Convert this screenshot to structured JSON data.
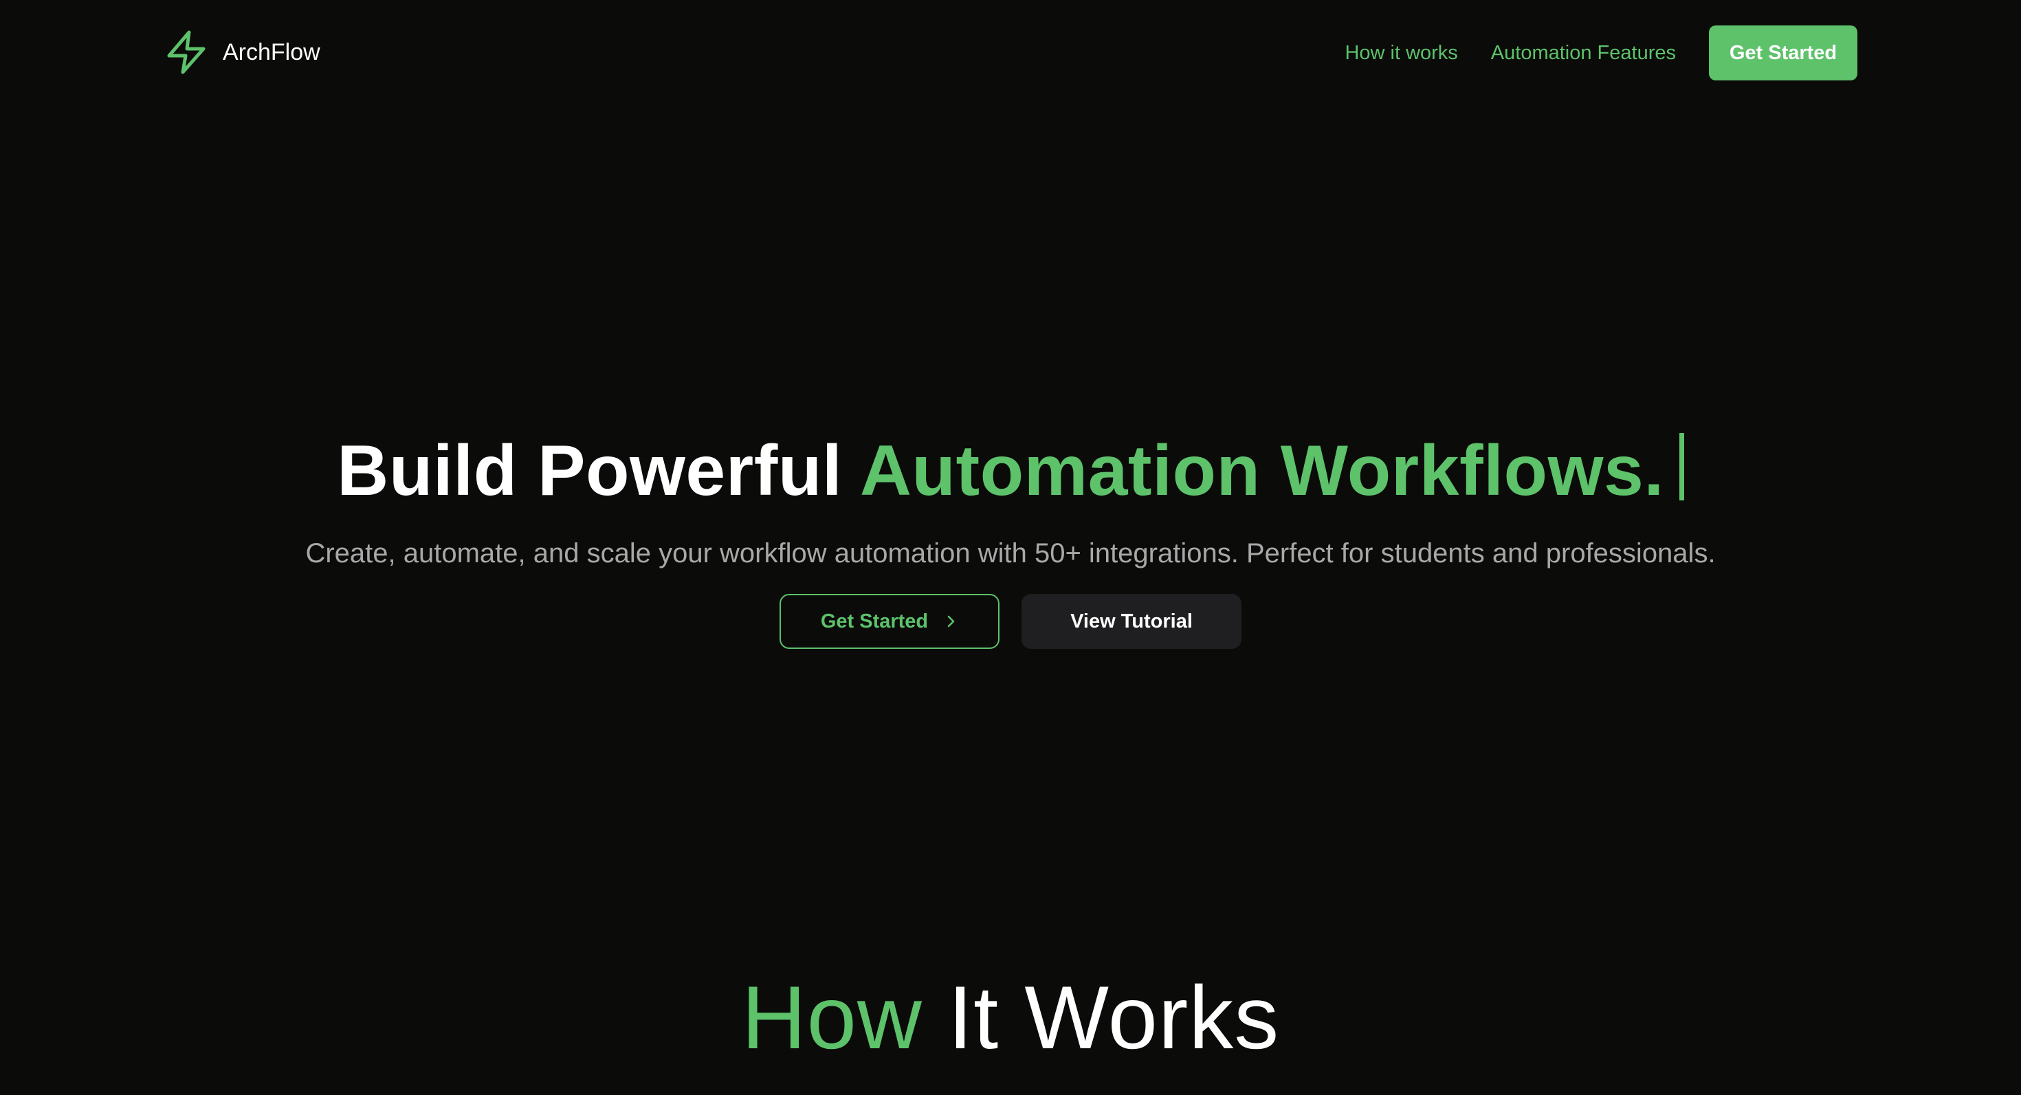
{
  "colors": {
    "background": "#0b0b0a",
    "accent": "#5dc26a",
    "muted_text": "#a8a8a8",
    "dark_button": "#1f1f21"
  },
  "brand": {
    "name": "ArchFlow",
    "icon": "lightning-bolt-icon"
  },
  "nav": {
    "links": [
      {
        "label": "How it works"
      },
      {
        "label": "Automation Features"
      }
    ],
    "cta_label": "Get Started"
  },
  "hero": {
    "title_part1": "Build Powerful",
    "title_part2": "Automation Workflows.",
    "subtitle": "Create, automate, and scale your workflow automation with 50+ integrations. Perfect for students and professionals.",
    "primary_button": {
      "label": "Get Started",
      "icon": "chevron-right-icon"
    },
    "secondary_button": {
      "label": "View Tutorial"
    }
  },
  "how_it_works": {
    "title_part1": "How",
    "title_part2": "It Works"
  }
}
